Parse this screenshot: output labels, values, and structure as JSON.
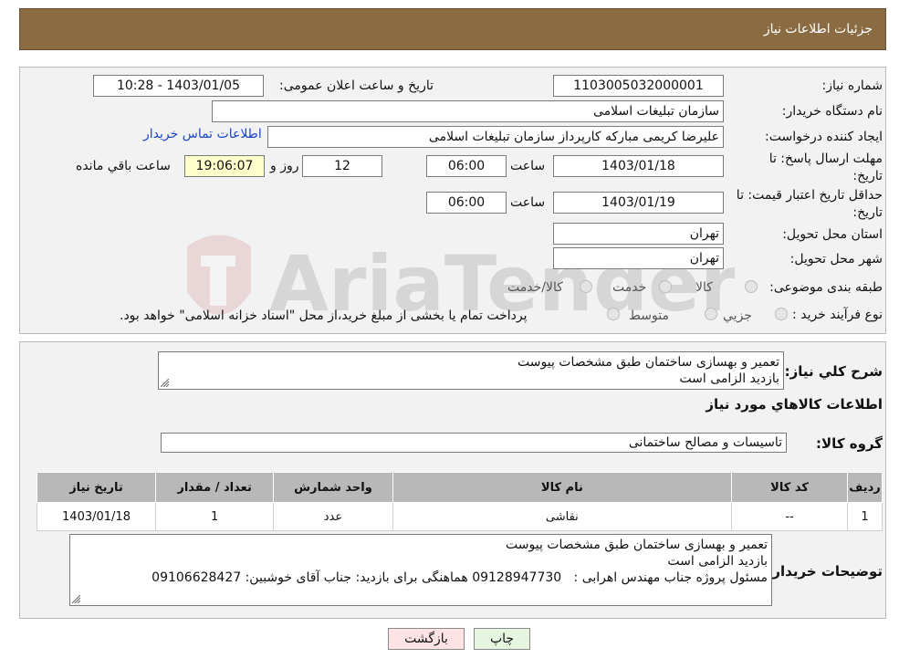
{
  "header": {
    "title": "جزئیات اطلاعات نیاز"
  },
  "watermark": {
    "text": "AriaTender.neT"
  },
  "form": {
    "need_number": {
      "label": "شماره نیاز:",
      "value": "1103005032000001"
    },
    "announce_datetime": {
      "label": "تاریخ و ساعت اعلان عمومی:",
      "value": "1403/01/05 - 10:28"
    },
    "buyer_org": {
      "label": "نام دستگاه خریدار:",
      "value": "سازمان تبلیغات اسلامی"
    },
    "creator": {
      "label": "ایجاد کننده درخواست:",
      "value": "علیرضا کریمی مبارکه کارپرداز سازمان تبلیغات اسلامی",
      "contact_link": "اطلاعات تماس خریدار"
    },
    "reply_deadline": {
      "label_line1": "مهلت ارسال پاسخ: تا",
      "label_line2": "تاریخ:",
      "date": "1403/01/18",
      "time_label": "ساعت",
      "time": "06:00",
      "days": "12",
      "days_label": "روز و",
      "remaining": "19:06:07",
      "remaining_label": "ساعت باقي مانده"
    },
    "price_validity": {
      "label_line1": "حداقل تاریخ اعتبار قیمت: تا",
      "label_line2": "تاریخ:",
      "date": "1403/01/19",
      "time_label": "ساعت",
      "time": "06:00"
    },
    "delivery_province": {
      "label": "استان محل تحویل:",
      "value": "تهران"
    },
    "delivery_city": {
      "label": "شهر محل تحویل:",
      "value": "تهران"
    },
    "category": {
      "label": "طبقه بندی موضوعی:",
      "options": [
        "کالا",
        "خدمت",
        "کالا/خدمت"
      ]
    },
    "purchase_type": {
      "label": "نوع فرآیند خرید :",
      "options": [
        "جزیي",
        "متوسط"
      ],
      "note": "پرداخت تمام یا بخشی از مبلغ خرید،از محل \"اسناد خزانه اسلامی\" خواهد بود."
    }
  },
  "description": {
    "label": "شرح کلي نياز:",
    "lines": [
      "تعمیر و بهسازی ساختمان طبق مشخصات پیوست",
      "بازدید الزامی است"
    ]
  },
  "goods": {
    "section_title": "اطلاعات کالاهاي مورد نياز",
    "group_label": "گروه کالا:",
    "group_value": "تاسیسات و مصالح ساختمانی",
    "columns": [
      "رديف",
      "کد کالا",
      "نام کالا",
      "واحد شمارش",
      "تعداد / مقدار",
      "تاریخ نیاز"
    ],
    "rows": [
      {
        "row": "1",
        "code": "--",
        "name": "نقاشی",
        "unit": "عدد",
        "qty": "1",
        "date": "1403/01/18"
      }
    ]
  },
  "buyer_notes": {
    "label": "توضيحات خريدار:",
    "lines": [
      "تعمیر و بهسازی ساختمان طبق مشخصات پیوست",
      "بازدید الزامی است",
      "مسئول پروژه جناب مهندس اهرابی :   09128947730 هماهنگی برای بازدید: جناب آقای خوشبین: 09106628427"
    ]
  },
  "buttons": {
    "print": "چاپ",
    "back": "بازگشت"
  },
  "colors": {
    "header_bg": "#8B6C42",
    "back_button_bg": "#fde3e3",
    "print_button_bg": "#e6f5e0",
    "link": "#1a46c8",
    "remaining_bg": "#ffffcc"
  }
}
